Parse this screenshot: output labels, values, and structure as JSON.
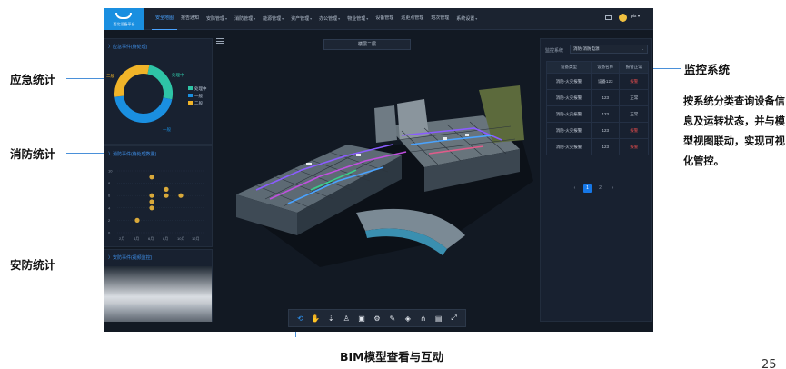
{
  "callouts": {
    "emergency": "应急统计",
    "fire": "消防统计",
    "security": "安防统计",
    "monitor_title": "监控系统",
    "monitor_desc": "按系统分类查询设备信息及运转状态，并与模型视图联动，实现可视化管控。",
    "bim": "BIM模型查看与互动"
  },
  "page_number": "25",
  "app": {
    "logo_text": "西北设备平台",
    "nav": [
      {
        "label": "安全地图",
        "active": true,
        "caret": false
      },
      {
        "label": "报告通知",
        "active": false,
        "caret": false
      },
      {
        "label": "安防管理",
        "active": false,
        "caret": true
      },
      {
        "label": "消防管理",
        "active": false,
        "caret": true
      },
      {
        "label": "能源管理",
        "active": false,
        "caret": true
      },
      {
        "label": "资产管理",
        "active": false,
        "caret": true
      },
      {
        "label": "办公管理",
        "active": false,
        "caret": true
      },
      {
        "label": "物业管理",
        "active": false,
        "caret": true
      },
      {
        "label": "设备管理",
        "active": false,
        "caret": false
      },
      {
        "label": "巡更点管理",
        "active": false,
        "caret": false
      },
      {
        "label": "班次管理",
        "active": false,
        "caret": false
      },
      {
        "label": "系统设置",
        "active": false,
        "caret": true
      }
    ],
    "user_name": "pis ▾",
    "panels": {
      "emergency_title": "〉应急事件(待处理)",
      "fire_title": "〉消防事件(待处理数量)",
      "security_title": "〉安防事件(视频监控)"
    },
    "donut": {
      "segments": [
        {
          "label": "处理中",
          "value": 25,
          "color": "#2ec4a6"
        },
        {
          "label": "一般",
          "value": 45,
          "color": "#1a8fe0"
        },
        {
          "label": "二般",
          "value": 30,
          "color": "#f0b429"
        }
      ],
      "legend": [
        "处理中",
        "一般",
        "二般"
      ],
      "pointer_labels": [
        "二般",
        "处理中",
        "一般"
      ]
    },
    "fire_chart": {
      "type": "scatter",
      "y_ticks": [
        "10",
        "8",
        "6",
        "4",
        "2",
        "0"
      ],
      "x_ticks": [
        "2月",
        "4月",
        "6月",
        "8月",
        "10月",
        "12月"
      ],
      "points": [
        [
          1,
          2
        ],
        [
          2,
          9
        ],
        [
          2,
          6
        ],
        [
          2,
          5
        ],
        [
          2,
          4
        ],
        [
          3,
          7
        ],
        [
          3,
          6
        ],
        [
          4,
          6
        ]
      ],
      "color": "#d9a93a"
    },
    "floor_select": "楼层二层",
    "monitor": {
      "label": "监控系统",
      "system_select": "消防-消防电源",
      "headers": [
        "设备类型",
        "设备名称",
        "报警正常"
      ],
      "rows": [
        {
          "type": "消防-火灾报警",
          "name": "设备123",
          "status": "报警",
          "alarm": true
        },
        {
          "type": "消防-火灾报警",
          "name": "123",
          "status": "正常",
          "alarm": false
        },
        {
          "type": "消防-火灾报警",
          "name": "123",
          "status": "正常",
          "alarm": false
        },
        {
          "type": "消防-火灾报警",
          "name": "123",
          "status": "报警",
          "alarm": true
        },
        {
          "type": "消防-火灾报警",
          "name": "123",
          "status": "报警",
          "alarm": true
        }
      ],
      "pages": [
        "‹",
        "1",
        "2",
        "›"
      ],
      "active_page": "1"
    },
    "toolbar": [
      {
        "icon": "rotate-icon",
        "glyph": "⟲",
        "active": true
      },
      {
        "icon": "hand-icon",
        "glyph": "✋",
        "active": false
      },
      {
        "icon": "move-down-icon",
        "glyph": "⇣",
        "active": false
      },
      {
        "icon": "person-icon",
        "glyph": "♙",
        "active": false
      },
      {
        "icon": "camera-icon",
        "glyph": "▣",
        "active": false
      },
      {
        "icon": "settings-icon",
        "glyph": "⚙",
        "active": false
      },
      {
        "icon": "measure-icon",
        "glyph": "✎",
        "active": false
      },
      {
        "icon": "box-icon",
        "glyph": "◈",
        "active": false
      },
      {
        "icon": "tree-icon",
        "glyph": "⋔",
        "active": false
      },
      {
        "icon": "layers-icon",
        "glyph": "▤",
        "active": false
      },
      {
        "icon": "fullscreen-icon",
        "glyph": "⤢",
        "active": false
      }
    ]
  }
}
